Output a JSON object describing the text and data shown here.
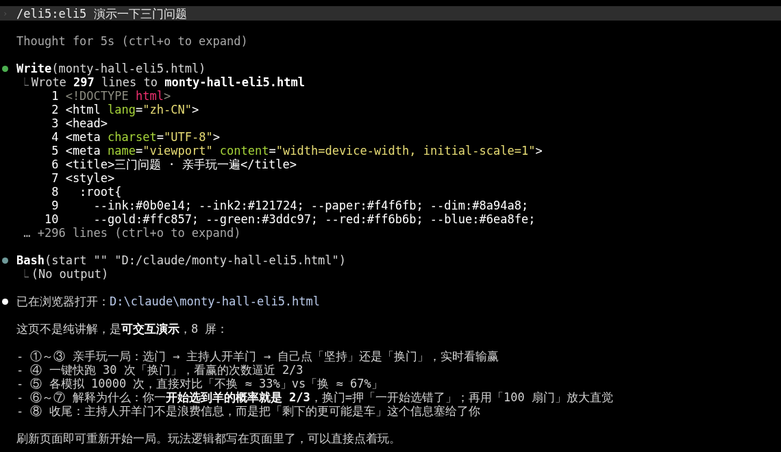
{
  "prompt": {
    "marker": "›",
    "text": "/eli5:eli5 演示一下三门问题"
  },
  "thinking": "Thought for 5s (ctrl+o to expand)",
  "tool_calls": [
    {
      "color": "#4caf50",
      "name": "Write",
      "args": "(monty-hall-eli5.html)",
      "result_marker": "⎿",
      "result": "Wrote **297** lines to **monty-hall-eli5.html**",
      "code_lines": [
        {
          "number": "1",
          "tokens": [
            {
              "kind": "comment",
              "text": "<!DOCTYPE "
            },
            {
              "kind": "keyword",
              "text": "html"
            },
            {
              "kind": "comment",
              "text": ">"
            }
          ]
        },
        {
          "number": "2",
          "tokens": [
            {
              "kind": "text",
              "text": "<html "
            },
            {
              "kind": "attr",
              "text": "lang"
            },
            {
              "kind": "text",
              "text": "="
            },
            {
              "kind": "string",
              "text": "\"zh-CN\""
            },
            {
              "kind": "text",
              "text": ">"
            }
          ]
        },
        {
          "number": "3",
          "tokens": [
            {
              "kind": "text",
              "text": "<head>"
            }
          ]
        },
        {
          "number": "4",
          "tokens": [
            {
              "kind": "text",
              "text": "<meta "
            },
            {
              "kind": "attr",
              "text": "charset"
            },
            {
              "kind": "text",
              "text": "="
            },
            {
              "kind": "string",
              "text": "\"UTF-8\""
            },
            {
              "kind": "text",
              "text": ">"
            }
          ]
        },
        {
          "number": "5",
          "tokens": [
            {
              "kind": "text",
              "text": "<meta "
            },
            {
              "kind": "attr",
              "text": "name"
            },
            {
              "kind": "text",
              "text": "="
            },
            {
              "kind": "string",
              "text": "\"viewport\" "
            },
            {
              "kind": "attr",
              "text": "content"
            },
            {
              "kind": "text",
              "text": "="
            },
            {
              "kind": "string",
              "text": "\"width=device-width, initial-scale=1\""
            },
            {
              "kind": "text",
              "text": ">"
            }
          ]
        },
        {
          "number": "6",
          "tokens": [
            {
              "kind": "text",
              "text": "<title>三门问题 · 亲手玩一遍</title>"
            }
          ]
        },
        {
          "number": "7",
          "tokens": [
            {
              "kind": "text",
              "text": "<style>"
            }
          ]
        },
        {
          "number": "8",
          "tokens": [
            {
              "kind": "text",
              "text": "  :root{"
            }
          ]
        },
        {
          "number": "9",
          "tokens": [
            {
              "kind": "text",
              "text": "    --ink:#0b0e14; --ink2:#121724; --paper:#f4f6fb; --dim:#8a94a8;"
            }
          ]
        },
        {
          "number": "10",
          "tokens": [
            {
              "kind": "text",
              "text": "    --gold:#ffc857; --green:#3ddc97; --red:#ff6b6b; --blue:#6ea8fe;"
            }
          ]
        }
      ],
      "more": "… +296 lines (ctrl+o to expand)"
    },
    {
      "color": "#6f9a9a",
      "name": "Bash",
      "args": "(start \"\" \"D:/claude/monty-hall-eli5.html\")",
      "result_marker": "⎿",
      "result": "(No output)"
    }
  ],
  "reply": {
    "color": "#ffffff",
    "label": "已在浏览器打开：",
    "path": "D:\\claude\\monty-hall-eli5.html",
    "intro": "这页不是纯讲解，是**可交互演示**，8 屏：",
    "bullets": [
      "- ①～③ 亲手玩一局：选门 → 主持人开羊门 → 自己点「坚持」还是「换门」，实时看输赢",
      "- ④ 一键快跑 30 次「换门」，看赢的次数逼近 2/3",
      "- ⑤ 各模拟 10000 次，直接对比「不换 ≈ 33%」vs「换 ≈ 67%」",
      "- ⑥～⑦ 解释为什么：你一**开始选到羊的概率就是 2/3**，换门=押「一开始选错了」；再用「100 扇门」放大直觉",
      "- ⑧ 收尾：主持人开羊门不是浪费信息，而是把「剩下的更可能是车」这个信息塞给了你"
    ],
    "closing": "刷新页面即可重新开始一局。玩法逻辑都写在页面里了，可以直接点着玩。"
  }
}
